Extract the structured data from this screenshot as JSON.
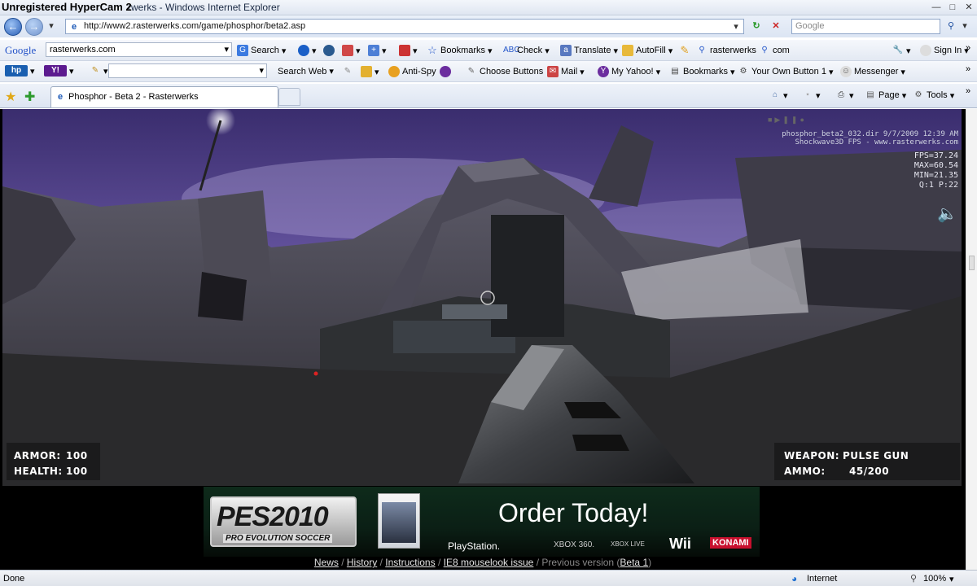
{
  "overlay": {
    "hypercam": "Unregistered HyperCam 2"
  },
  "window": {
    "title": "rwerks - Windows Internet Explorer"
  },
  "address": {
    "url": "http://www2.rasterwerks.com/game/phosphor/beta2.asp",
    "search_placeholder": "Google"
  },
  "google_toolbar": {
    "brand": "Google",
    "query": "rasterwerks.com",
    "items": [
      "Search",
      "Bookmarks",
      "Check",
      "Translate",
      "AutoFill",
      "rasterwerks",
      "com"
    ],
    "sign_in": "Sign In"
  },
  "yahoo_toolbar": {
    "search_web": "Search Web",
    "anti_spy": "Anti-Spy",
    "choose_buttons": "Choose Buttons",
    "mail": "Mail",
    "my_yahoo": "My Yahoo!",
    "bookmarks": "Bookmarks",
    "your_own_button": "Your Own Button 1",
    "messenger": "Messenger"
  },
  "tabs": [
    {
      "label": "Phosphor - Beta 2 - Rasterwerks"
    }
  ],
  "command_bar": {
    "page": "Page",
    "tools": "Tools"
  },
  "game": {
    "info_line1": "phosphor_beta2_032.dir 9/7/2009 12:39 AM",
    "info_line2": "Shockwave3D FPS - www.rasterwerks.com",
    "fps": "FPS=37.24",
    "max": "MAX=60.54",
    "min": "MIN=21.35",
    "quality": "Q:1 P:22",
    "armor_label": "ARMOR:",
    "armor_value": "100",
    "health_label": "HEALTH:",
    "health_value": "100",
    "weapon_label": "WEAPON:",
    "weapon_value": "PULSE GUN",
    "ammo_label": "AMMO:",
    "ammo_value": "45/200"
  },
  "ad": {
    "brand": "PES2010",
    "subtitle": "PRO EVOLUTION SOCCER",
    "cta": "Order Today!",
    "platforms": [
      "PlayStation.",
      "XBOX 360.",
      "XBOX LIVE",
      "Wii"
    ],
    "publisher": "KONAMI"
  },
  "footer_links": {
    "news": "News",
    "history": "History",
    "instructions": "Instructions",
    "ie8": "IE8 mouselook issue",
    "prev_prefix": "Previous version (",
    "beta1": "Beta 1",
    "prev_suffix": ")"
  },
  "status": {
    "text": "Done",
    "zone": "Internet",
    "zoom": "100%"
  },
  "colors": {
    "sky": "#5b4a8f",
    "hud_text": "#ffffff",
    "title_bar": "#dfe6f1"
  }
}
